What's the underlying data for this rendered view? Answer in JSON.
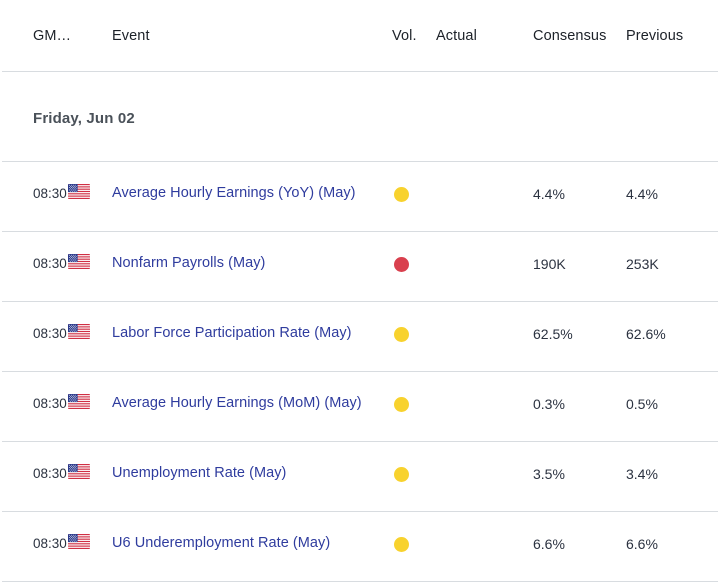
{
  "table": {
    "columns": {
      "time": "GM…",
      "event": "Event",
      "volatility": "Vol.",
      "actual": "Actual",
      "consensus": "Consensus",
      "previous": "Previous"
    },
    "date_group": "Friday, Jun 02",
    "rows": [
      {
        "time": "08:30",
        "country_icon": "us-flag-icon",
        "event": "Average Hourly Earnings (YoY) (May)",
        "volatility": "medium",
        "actual": "",
        "consensus": "4.4%",
        "previous": "4.4%"
      },
      {
        "time": "08:30",
        "country_icon": "us-flag-icon",
        "event": "Nonfarm Payrolls (May)",
        "volatility": "high",
        "actual": "",
        "consensus": "190K",
        "previous": "253K"
      },
      {
        "time": "08:30",
        "country_icon": "us-flag-icon",
        "event": "Labor Force Participation Rate (May)",
        "volatility": "medium",
        "actual": "",
        "consensus": "62.5%",
        "previous": "62.6%"
      },
      {
        "time": "08:30",
        "country_icon": "us-flag-icon",
        "event": "Average Hourly Earnings (MoM) (May)",
        "volatility": "medium",
        "actual": "",
        "consensus": "0.3%",
        "previous": "0.5%"
      },
      {
        "time": "08:30",
        "country_icon": "us-flag-icon",
        "event": "Unemployment Rate (May)",
        "volatility": "medium",
        "actual": "",
        "consensus": "3.5%",
        "previous": "3.4%"
      },
      {
        "time": "08:30",
        "country_icon": "us-flag-icon",
        "event": "U6 Underemployment Rate (May)",
        "volatility": "medium",
        "actual": "",
        "consensus": "6.6%",
        "previous": "6.6%"
      }
    ]
  },
  "colors": {
    "volatility_high": "#d9404e",
    "volatility_medium": "#f8d22e",
    "link": "#2f3c9e",
    "separator": "#d8dce0",
    "date_text": "#4a5159"
  }
}
